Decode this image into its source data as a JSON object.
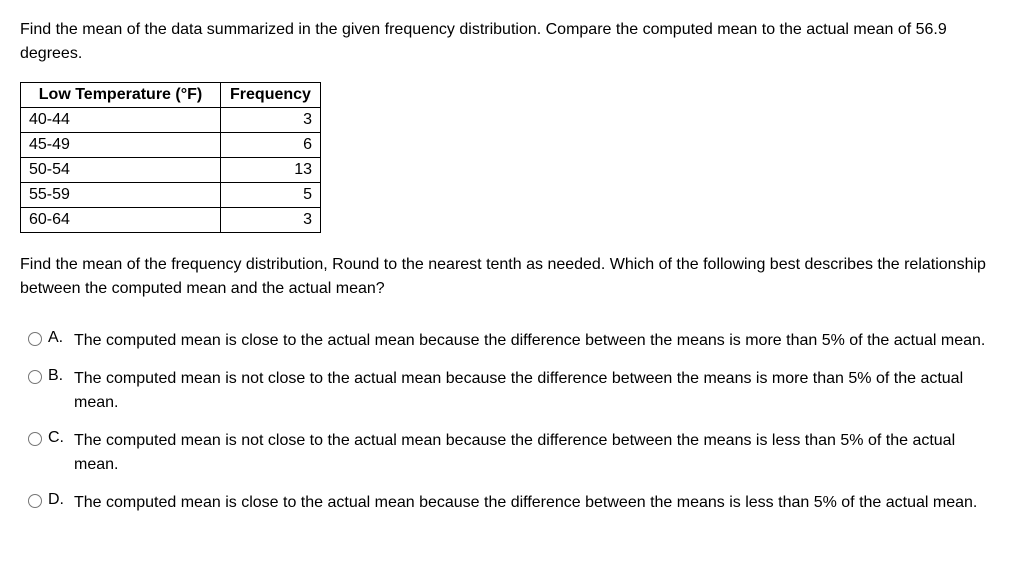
{
  "question": {
    "intro": "Find the mean of the data summarized in the given frequency distribution. Compare the computed mean to the actual mean of 56.9 degrees."
  },
  "table": {
    "headers": {
      "col1": "Low Temperature (°F)",
      "col2": "Frequency"
    },
    "rows": [
      {
        "range": "40-44",
        "freq": "3"
      },
      {
        "range": "45-49",
        "freq": "6"
      },
      {
        "range": "50-54",
        "freq": "13"
      },
      {
        "range": "55-59",
        "freq": "5"
      },
      {
        "range": "60-64",
        "freq": "3"
      }
    ]
  },
  "sub_question": "Find the mean of the frequency distribution, Round to the nearest tenth as needed.  Which of the following best describes the relationship between the computed mean and the actual mean?",
  "options": [
    {
      "letter": "A.",
      "text": "The computed mean is close to the actual mean because the difference between the means is more than 5% of the actual mean."
    },
    {
      "letter": "B.",
      "text": "The computed mean is not close to the actual mean because the difference between the means is more than 5% of the actual mean."
    },
    {
      "letter": "C.",
      "text": "The computed mean is not close to the actual mean because the difference between the means is less than 5% of the actual mean."
    },
    {
      "letter": "D.",
      "text": "The computed mean is close to the actual mean because the difference between the means is less than 5% of the actual mean."
    }
  ]
}
